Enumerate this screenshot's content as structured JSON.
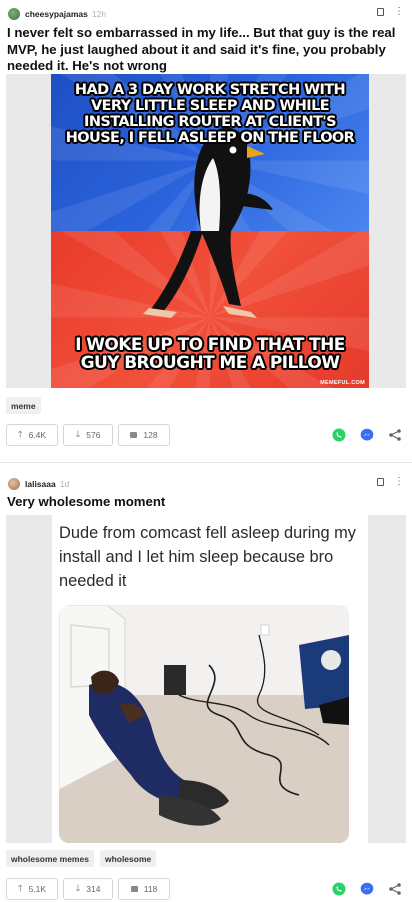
{
  "posts": [
    {
      "author": "cheesypajamas",
      "time": "12h",
      "title": "I never felt so embarrassed in my life... But that guy is the real MVP, he just laughed about it and said it's fine, you probably needed it. He's not wrong",
      "meme": {
        "top_text": "HAD A 3 DAY WORK STRETCH WITH VERY LITTLE SLEEP AND WHILE INSTALLING ROUTER AT CLIENT'S HOUSE, I FELL ASLEEP ON THE FLOOR",
        "bottom_text": "I WOKE UP TO FIND THAT THE GUY BROUGHT ME A PILLOW",
        "watermark": "MEMEFUL.COM"
      },
      "tags": [
        "meme"
      ],
      "upvotes": "6.4K",
      "downvotes": "576",
      "comments": "128"
    },
    {
      "author": "lalisaaa",
      "time": "1d",
      "title": "Very wholesome moment",
      "image_text": "Dude from comcast fell asleep during my install and I let him sleep because bro needed it",
      "tags": [
        "wholesome memes",
        "wholesome"
      ],
      "upvotes": "5.1K",
      "downvotes": "314",
      "comments": "118"
    }
  ],
  "icons": {
    "save": "save-icon",
    "more": "more-icon",
    "upvote": "arrow-up-icon",
    "downvote": "arrow-down-icon",
    "comment": "comment-icon",
    "whatsapp": "whatsapp-icon",
    "messenger": "messenger-icon",
    "share": "share-icon"
  },
  "colors": {
    "whatsapp": "#25d366",
    "messenger": "#3b6cf5",
    "meme_top": "#2a63dc",
    "meme_bottom": "#ef4a36"
  }
}
